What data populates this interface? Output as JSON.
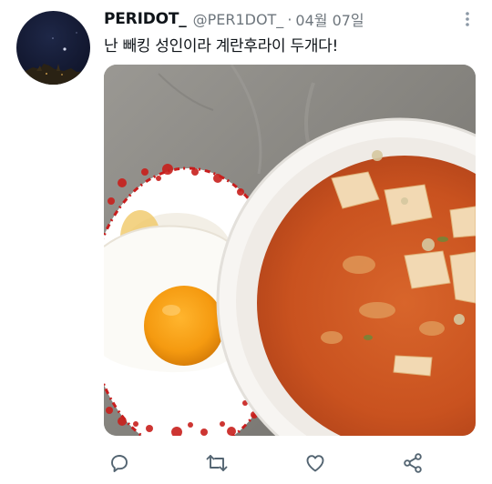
{
  "tweet": {
    "display_name": "PERIDOT_",
    "handle": "@PER1DOT_",
    "separator": "·",
    "date": "04월 07일",
    "text": "난 빼킹 성인이라 계란후라이 두개다!"
  },
  "avatar": {
    "icon": "night-sky-avatar"
  },
  "actions": [
    "reply-icon",
    "retweet-icon",
    "like-icon",
    "share-icon"
  ],
  "colors": {
    "text": "#0f1419",
    "muted": "#6e767d",
    "icon": "#536471"
  }
}
